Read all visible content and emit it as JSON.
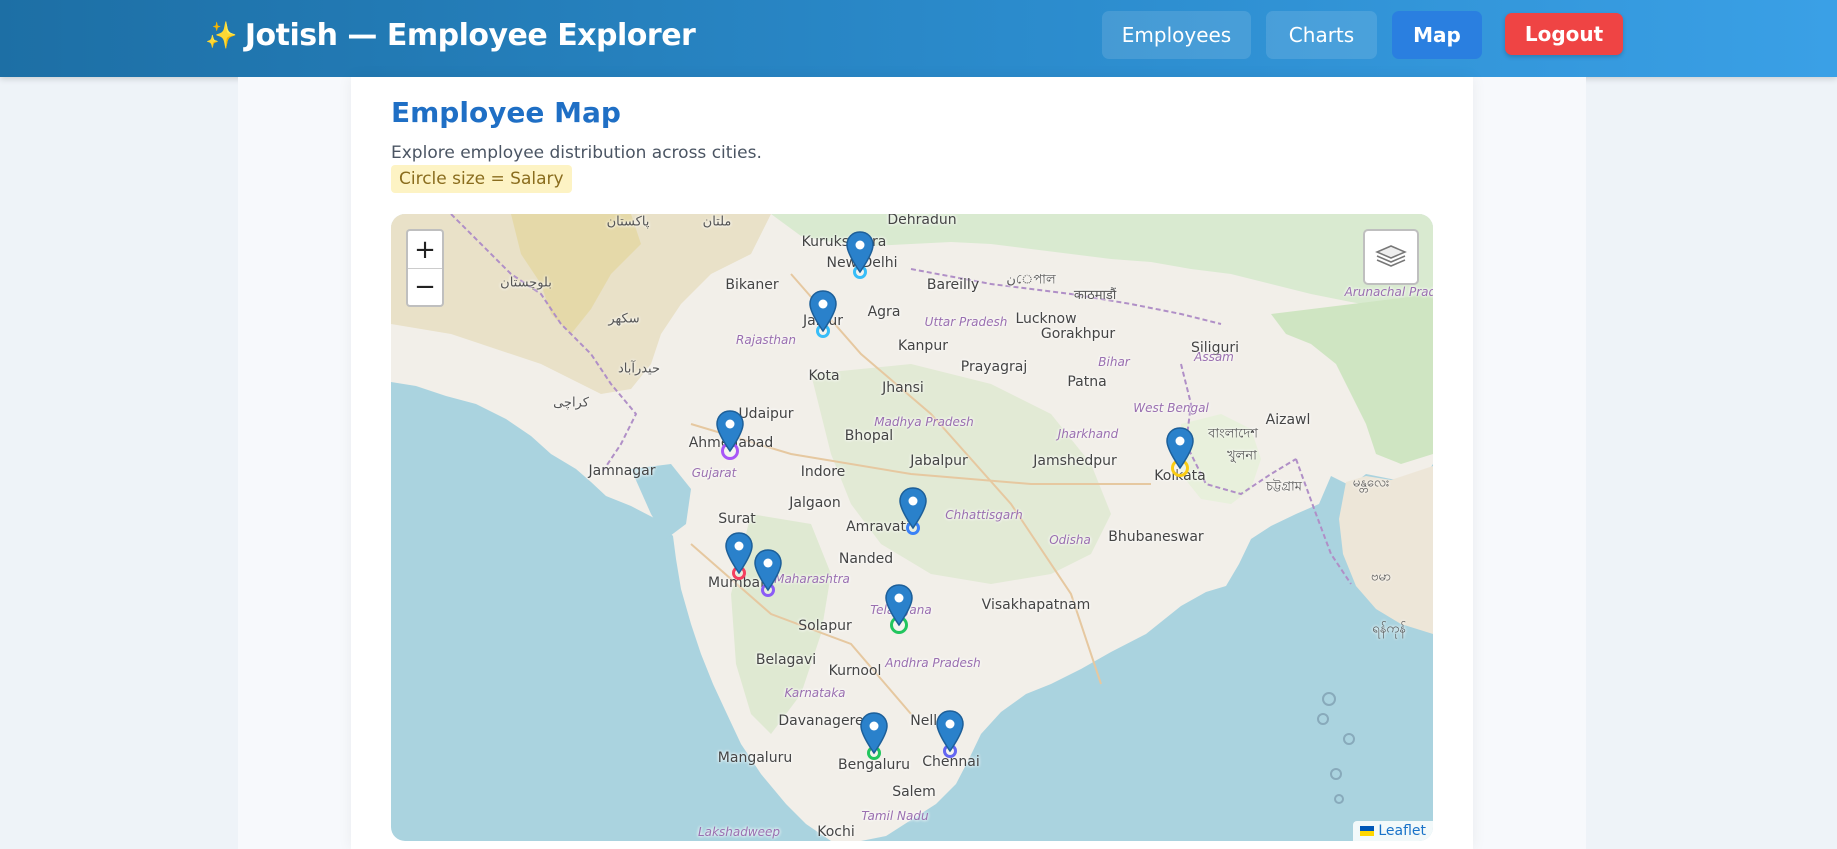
{
  "header": {
    "brand_icon": "sparkles-icon",
    "title": "Jotish — Employee Explorer",
    "nav": [
      {
        "label": "Employees",
        "active": false
      },
      {
        "label": "Charts",
        "active": false
      },
      {
        "label": "Map",
        "active": true
      }
    ],
    "logout_label": "Logout"
  },
  "main": {
    "title": "Employee Map",
    "description": "Explore employee distribution across cities.",
    "legend_badge": "Circle size = Salary"
  },
  "map": {
    "zoom_in_label": "+",
    "zoom_out_label": "−",
    "layers_icon": "layers-icon",
    "attribution": "Leaflet",
    "city_labels": [
      "Dehradun",
      "Kurukshetra",
      "New Delhi",
      "Bikaner",
      "Jaipur",
      "Agra",
      "Bareilly",
      "Kanpur",
      "Lucknow",
      "Prayagraj",
      "Gorakhpur",
      "Patna",
      "Siliguri",
      "Kota",
      "Jhansi",
      "Udaipur",
      "Ahmedabad",
      "Bhopal",
      "Jabalpur",
      "Jamshedpur",
      "Kolkata",
      "Aizawl",
      "Jamnagar",
      "Indore",
      "Jalgaon",
      "Amravati",
      "Bhubaneswar",
      "Surat",
      "Nanded",
      "Mumbai",
      "Visakhapatnam",
      "Solapur",
      "Belagavi",
      "Kurnool",
      "Davanagere",
      "Nellore",
      "Mangaluru",
      "Bengaluru",
      "Chennai",
      "Salem",
      "Kochi"
    ],
    "region_labels": [
      "Rajasthan",
      "Uttar Pradesh",
      "Madhya Pradesh",
      "Gujarat",
      "Bihar",
      "West Bengal",
      "Jharkhand",
      "Chhattisgarh",
      "Odisha",
      "Maharashtra",
      "Telangana",
      "Andhra Pradesh",
      "Karnataka",
      "Tamil Nadu",
      "Lakshadweep",
      "Assam",
      "Arunachal Pradesh"
    ],
    "foreign_labels": [
      "پاکستان",
      "ملتان",
      "بلوچستان",
      "سکھر",
      "حیدرآباد",
      "کراچی",
      "نেপাল",
      "काठमाडौं",
      "বাংলাদেশ",
      "খুলনা",
      "চট্টগ্রাম",
      "မန္တလေး",
      "ဗမာ",
      "ရန်ကုန်",
      "Assam"
    ],
    "markers": [
      {
        "city": "New Delhi",
        "circle_color": "#38bdf8",
        "salary_rank": 2
      },
      {
        "city": "Jaipur",
        "circle_color": "#38bdf8",
        "salary_rank": 2
      },
      {
        "city": "Ahmedabad",
        "circle_color": "#a855f7",
        "salary_rank": 4
      },
      {
        "city": "Kolkata",
        "circle_color": "#facc15",
        "salary_rank": 4
      },
      {
        "city": "Nagpur",
        "circle_color": "#3b82f6",
        "salary_rank": 3
      },
      {
        "city": "Mumbai",
        "circle_color": "#f43f5e",
        "salary_rank": 3
      },
      {
        "city": "Pune",
        "circle_color": "#8b5cf6",
        "salary_rank": 3
      },
      {
        "city": "Hyderabad",
        "circle_color": "#22c55e",
        "salary_rank": 4
      },
      {
        "city": "Bengaluru",
        "circle_color": "#22c55e",
        "salary_rank": 3
      },
      {
        "city": "Chennai",
        "circle_color": "#6366f1",
        "salary_rank": 3
      }
    ]
  }
}
